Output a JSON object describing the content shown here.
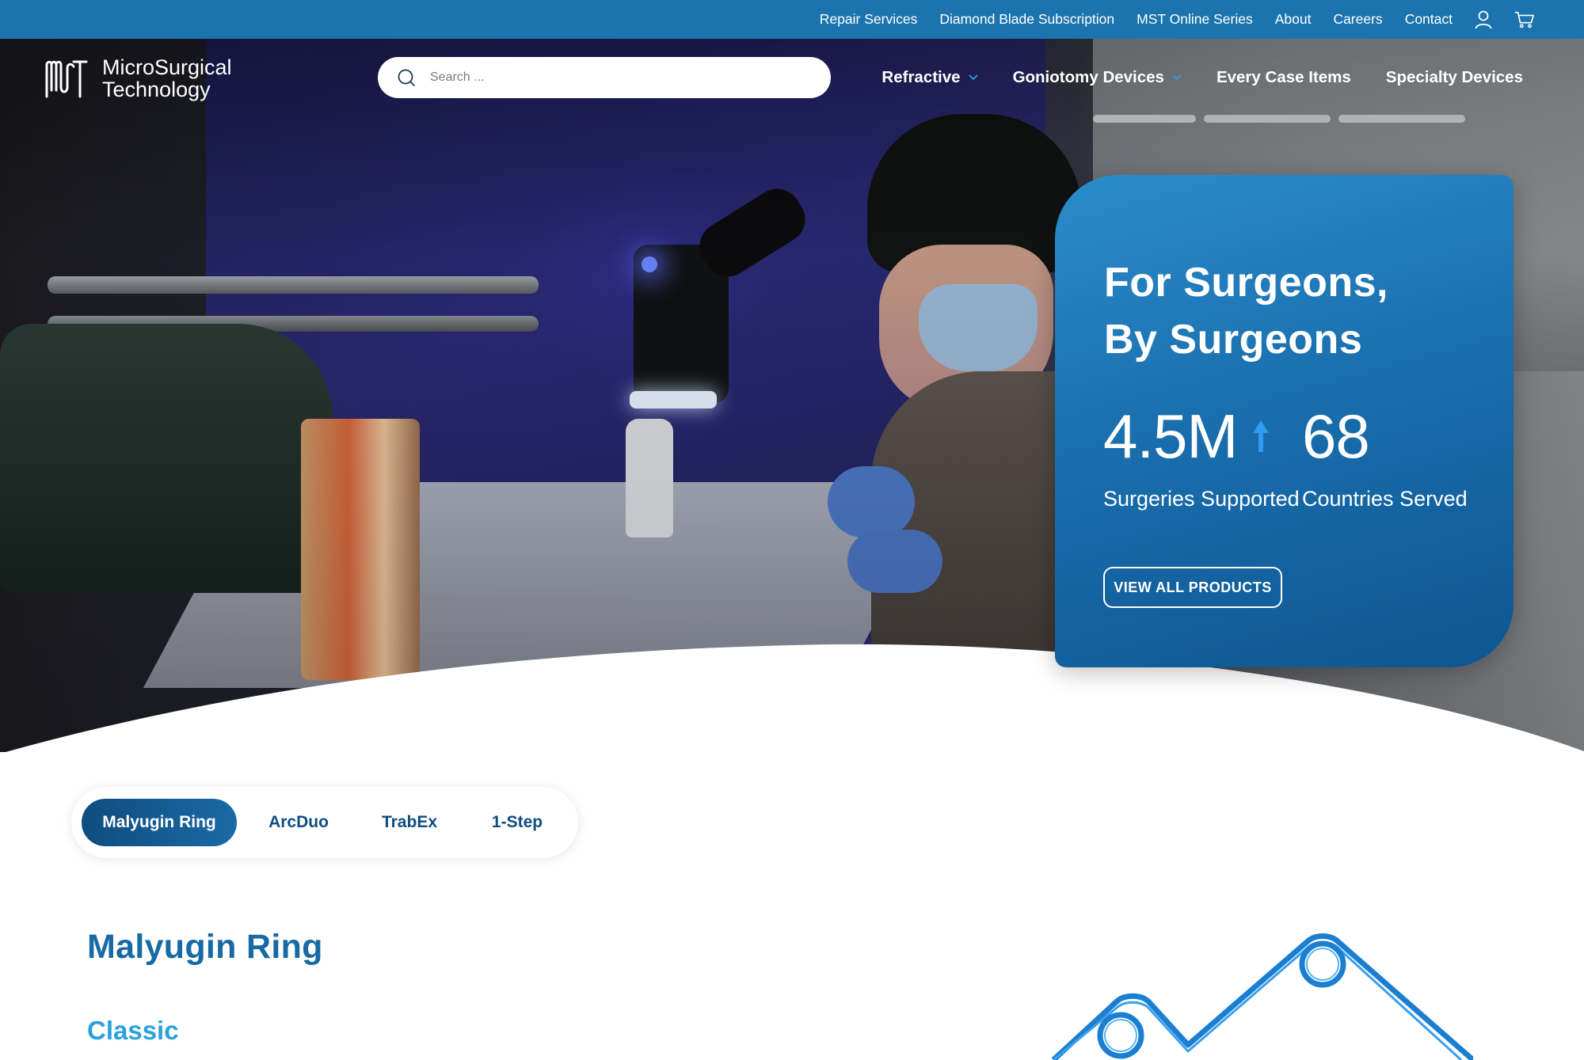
{
  "topbar": {
    "links": [
      "Repair Services",
      "Diamond Blade Subscription",
      "MST Online Series",
      "About",
      "Careers",
      "Contact"
    ],
    "icons": [
      "user-icon",
      "cart-icon"
    ]
  },
  "logo": {
    "mark": "MST",
    "line1": "MicroSurgical",
    "line2": "Technology"
  },
  "search": {
    "placeholder": "Search ...",
    "value": ""
  },
  "mainnav": [
    {
      "label": "Refractive",
      "has_dropdown": true
    },
    {
      "label": "Goniotomy Devices",
      "has_dropdown": true
    },
    {
      "label": "Every Case Items",
      "has_dropdown": false
    },
    {
      "label": "Specialty Devices",
      "has_dropdown": false
    }
  ],
  "hero": {
    "title_line1": "For Surgeons,",
    "title_line2": "By Surgeons",
    "stats": [
      {
        "value": "4.5M",
        "label": "Surgeries Supported",
        "icon": "arrow-up-icon"
      },
      {
        "value": "68",
        "label": "Countries Served"
      }
    ],
    "cta": "VIEW ALL PRODUCTS"
  },
  "products": {
    "tabs": [
      "Malyugin Ring",
      "ArcDuo",
      "TrabEx",
      "1-Step"
    ],
    "active_tab": "Malyugin Ring",
    "title": "Malyugin Ring",
    "subtitle": "Classic"
  },
  "colors": {
    "topbar": "#1c74ae",
    "card": "#1a6fae",
    "accent": "#2aa1dc",
    "heading": "#176aa3",
    "tab_active": "#0f4c7e"
  }
}
